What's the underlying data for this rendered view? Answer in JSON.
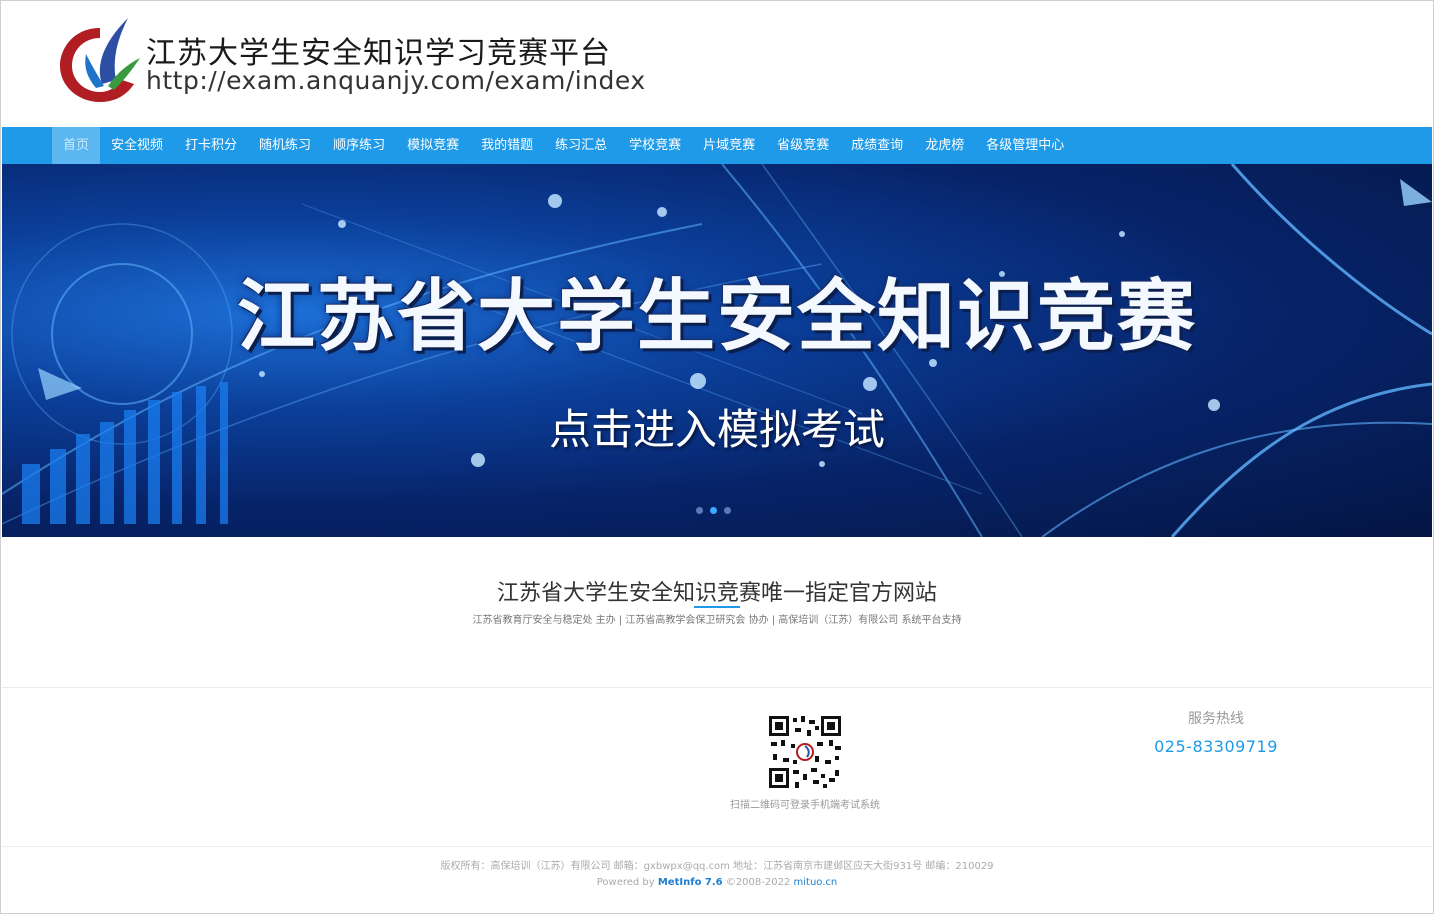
{
  "header": {
    "title": "江苏大学生安全知识学习竞赛平台",
    "url": "http://exam.anquanjy.com/exam/index"
  },
  "nav": {
    "items": [
      {
        "label": "首页",
        "active": true
      },
      {
        "label": "安全视频"
      },
      {
        "label": "打卡积分"
      },
      {
        "label": "随机练习"
      },
      {
        "label": "顺序练习"
      },
      {
        "label": "模拟竞赛"
      },
      {
        "label": "我的错题"
      },
      {
        "label": "练习汇总"
      },
      {
        "label": "学校竞赛"
      },
      {
        "label": "片域竞赛"
      },
      {
        "label": "省级竞赛"
      },
      {
        "label": "成绩查询"
      },
      {
        "label": "龙虎榜"
      },
      {
        "label": "各级管理中心"
      }
    ]
  },
  "banner": {
    "title": "江苏省大学生安全知识竞赛",
    "subtitle": "点击进入模拟考试",
    "slides": 3,
    "active_slide": 2
  },
  "intro": {
    "title": "江苏省大学生安全知识竞赛唯一指定官方网站",
    "subtitle": "江苏省教育厅安全与稳定处 主办 | 江苏省高教学会保卫研究会 协办 | 高保培训（江苏）有限公司 系统平台支持"
  },
  "footer": {
    "qr_caption": "扫描二维码可登录手机端考试系统",
    "hotline_label": "服务热线",
    "hotline_number": "025-83309719",
    "copyright": "版权所有：高保培训（江苏）有限公司  邮箱：gxbwpx@qq.com  地址：江苏省南京市建邺区应天大街931号 邮编：210029",
    "powered_prefix": "Powered by ",
    "powered_brand": "MetInfo 7.6",
    "powered_years": " ©2008-2022 ",
    "powered_site": "mituo.cn"
  },
  "colors": {
    "nav_bg": "#1e9ae8",
    "accent": "#1e9ae8"
  }
}
